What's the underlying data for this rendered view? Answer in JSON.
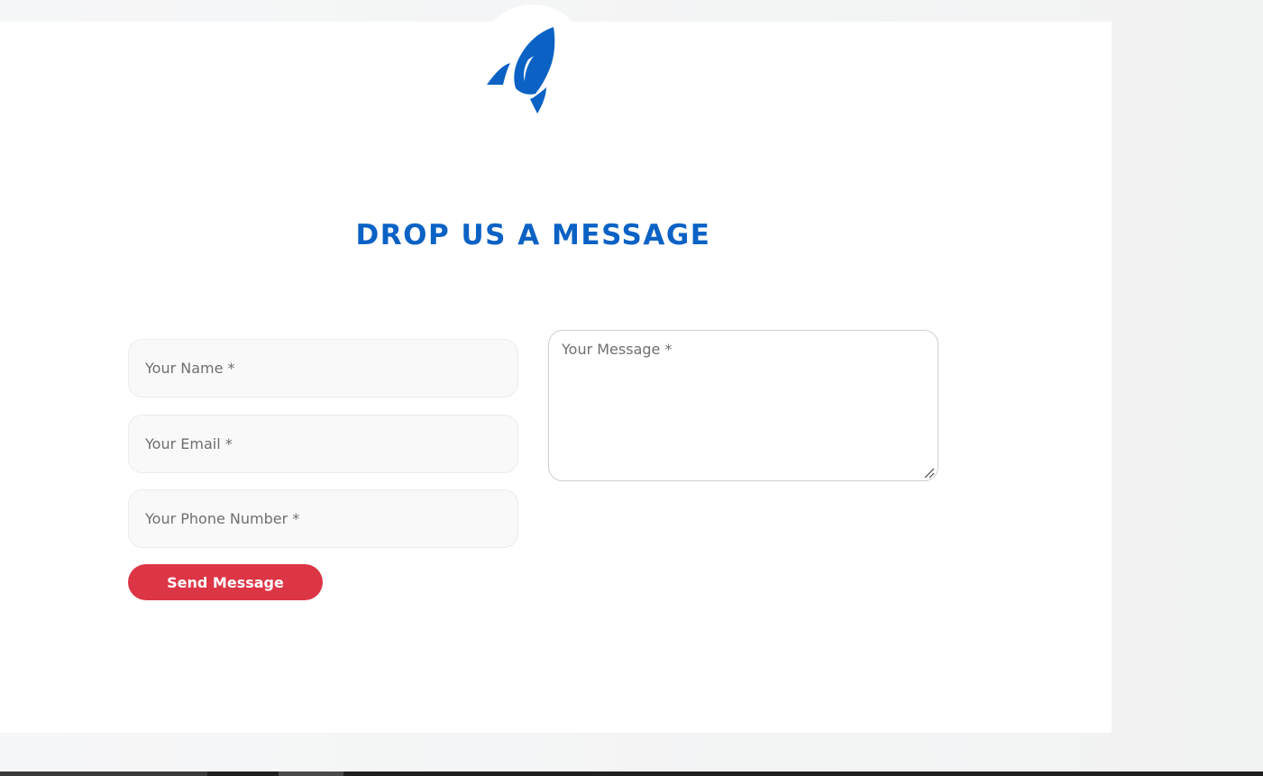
{
  "section": {
    "title": "DROP US A MESSAGE"
  },
  "form": {
    "name_placeholder": "Your Name *",
    "email_placeholder": "Your Email *",
    "phone_placeholder": "Your Phone Number *",
    "message_placeholder": "Your Message *",
    "submit_label": "Send Message"
  },
  "icons": {
    "logo": "rocket-icon",
    "grip": "resize-grip-icon"
  },
  "colors": {
    "accent": "#0b62c4",
    "button": "#dc3545",
    "background": "#f3f4f4"
  }
}
